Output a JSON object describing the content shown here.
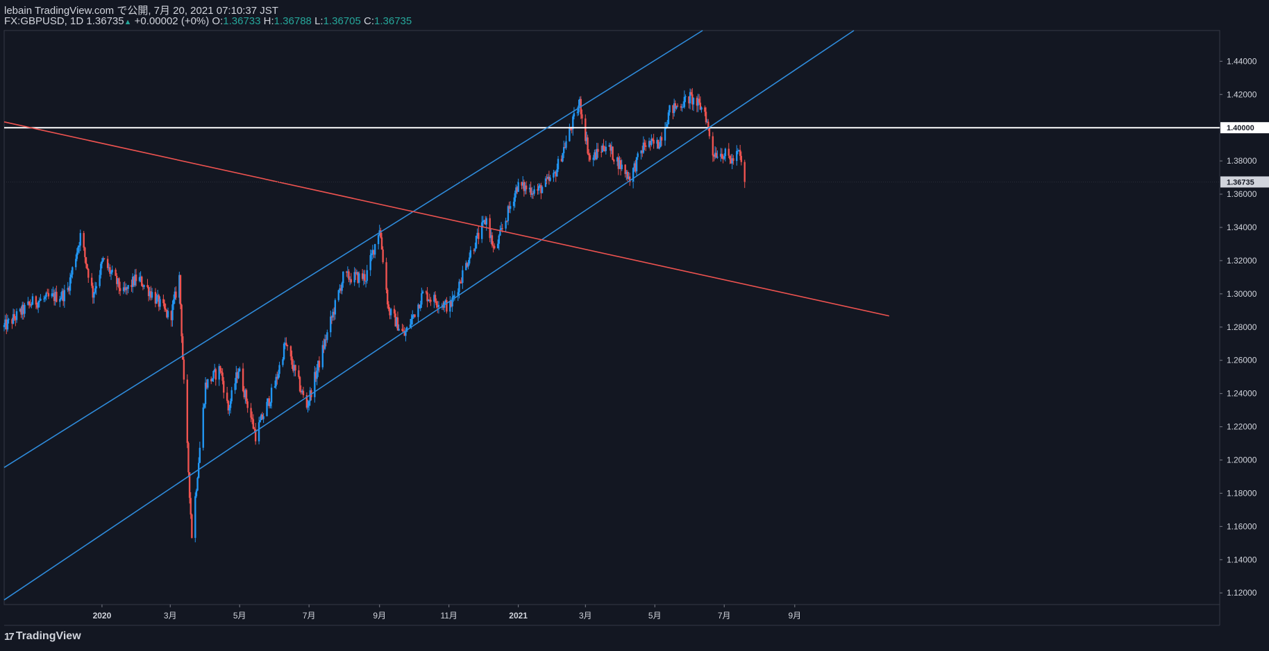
{
  "header": {
    "line1": "lebain TradingView.com で公開, 7月 20, 2021 07:10:37 JST",
    "symbol": "FX:GBPUSD, 1D",
    "last": "1.36735",
    "change": "+0.00002 (+0%)",
    "o_label": "O:",
    "o": "1.36733",
    "h_label": "H:",
    "h": "1.36788",
    "l_label": "L:",
    "l": "1.36705",
    "c_label": "C:",
    "c": "1.36735"
  },
  "footer": {
    "brand": "TradingView",
    "brand_mark": "17"
  },
  "colors": {
    "background": "#131722",
    "up": "#2196f3",
    "down": "#ef5350",
    "channel": "#2f8cdc",
    "resistance": "#ef5350",
    "level": "#ffffff",
    "ohlc_value": "#26a69a"
  },
  "chart_data": {
    "type": "candlestick",
    "symbol": "FX:GBPUSD",
    "timeframe": "1D",
    "y_ticks": [
      "1.12000",
      "1.14000",
      "1.16000",
      "1.18000",
      "1.20000",
      "1.22000",
      "1.24000",
      "1.26000",
      "1.28000",
      "1.30000",
      "1.32000",
      "1.34000",
      "1.36000",
      "1.38000",
      "1.40000",
      "1.42000",
      "1.44000"
    ],
    "x_ticks": [
      "2020",
      "3月",
      "5月",
      "7月",
      "9月",
      "11月",
      "2021",
      "3月",
      "5月",
      "7月",
      "9月"
    ],
    "ylim": [
      1.113,
      1.4585
    ],
    "last_price": "1.36735",
    "horizontal_level": {
      "value": 1.4,
      "label": "1.40000"
    },
    "trendlines": [
      {
        "name": "channel-upper",
        "color": "#2f8cdc",
        "points": [
          [
            "2019-10-07",
            1.1955
          ],
          [
            "2021-06-12",
            1.4585
          ]
        ]
      },
      {
        "name": "channel-lower",
        "color": "#2f8cdc",
        "points": [
          [
            "2019-10-07",
            1.1158
          ],
          [
            "2021-10-23",
            1.4585
          ]
        ]
      },
      {
        "name": "resistance-line",
        "color": "#ef5350",
        "points": [
          [
            "2019-10-07",
            1.4035
          ],
          [
            "2021-11-23",
            1.2867
          ]
        ]
      }
    ],
    "anchors": [
      [
        "2019-10-07",
        1.28
      ],
      [
        "2019-11-01",
        1.295
      ],
      [
        "2019-12-01",
        1.3
      ],
      [
        "2019-12-13",
        1.335
      ],
      [
        "2019-12-24",
        1.3
      ],
      [
        "2020-01-02",
        1.32
      ],
      [
        "2020-01-20",
        1.3
      ],
      [
        "2020-02-01",
        1.31
      ],
      [
        "2020-02-14",
        1.3
      ],
      [
        "2020-03-01",
        1.285
      ],
      [
        "2020-03-09",
        1.31
      ],
      [
        "2020-03-13",
        1.245
      ],
      [
        "2020-03-20",
        1.155
      ],
      [
        "2020-03-26",
        1.2
      ],
      [
        "2020-04-01",
        1.245
      ],
      [
        "2020-04-14",
        1.255
      ],
      [
        "2020-04-21",
        1.23
      ],
      [
        "2020-04-30",
        1.255
      ],
      [
        "2020-05-15",
        1.215
      ],
      [
        "2020-06-01",
        1.245
      ],
      [
        "2020-06-10",
        1.27
      ],
      [
        "2020-06-29",
        1.232
      ],
      [
        "2020-07-31",
        1.31
      ],
      [
        "2020-08-20",
        1.31
      ],
      [
        "2020-09-01",
        1.34
      ],
      [
        "2020-09-09",
        1.29
      ],
      [
        "2020-09-23",
        1.275
      ],
      [
        "2020-10-09",
        1.3
      ],
      [
        "2020-11-02",
        1.292
      ],
      [
        "2020-11-20",
        1.325
      ],
      [
        "2020-12-04",
        1.345
      ],
      [
        "2020-12-11",
        1.325
      ],
      [
        "2020-12-31",
        1.365
      ],
      [
        "2021-01-18",
        1.362
      ],
      [
        "2021-02-01",
        1.37
      ],
      [
        "2021-02-24",
        1.415
      ],
      [
        "2021-03-05",
        1.38
      ],
      [
        "2021-03-19",
        1.39
      ],
      [
        "2021-03-31",
        1.378
      ],
      [
        "2021-04-09",
        1.37
      ],
      [
        "2021-04-22",
        1.39
      ],
      [
        "2021-05-04",
        1.39
      ],
      [
        "2021-05-14",
        1.41
      ],
      [
        "2021-06-01",
        1.418
      ],
      [
        "2021-06-14",
        1.41
      ],
      [
        "2021-06-21",
        1.385
      ],
      [
        "2021-06-29",
        1.385
      ],
      [
        "2021-07-08",
        1.38
      ],
      [
        "2021-07-14",
        1.385
      ],
      [
        "2021-07-19",
        1.3673
      ]
    ]
  }
}
